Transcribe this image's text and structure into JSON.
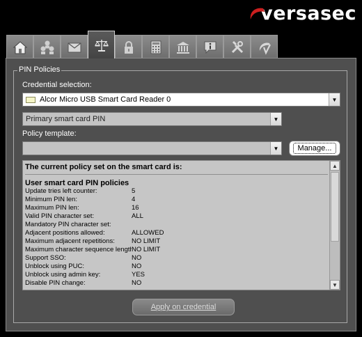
{
  "brand": {
    "logo_text": "versasec",
    "accent": "#cc1f1f"
  },
  "tabs": [
    {
      "name": "home-icon"
    },
    {
      "name": "users-icon"
    },
    {
      "name": "mail-icon"
    },
    {
      "name": "scales-icon",
      "active": true
    },
    {
      "name": "lock-icon"
    },
    {
      "name": "calculator-icon"
    },
    {
      "name": "bank-icon"
    },
    {
      "name": "info-icon"
    },
    {
      "name": "tools-icon"
    },
    {
      "name": "cv-icon"
    }
  ],
  "group": {
    "title": "PIN Policies"
  },
  "credential": {
    "label": "Credential selection:",
    "reader": "Alcor Micro USB Smart Card Reader 0",
    "pin_type": "Primary smart card PIN"
  },
  "policy": {
    "label": "Policy template:",
    "value": "",
    "manage_label": "Manage..."
  },
  "policy_list": {
    "heading": "The current policy set on the smart card is:",
    "section": "User smart card PIN policies",
    "rows": [
      {
        "key": "Update tries left counter:",
        "value": "5"
      },
      {
        "key": "Minimum PIN len:",
        "value": "4"
      },
      {
        "key": "Maximum PIN len:",
        "value": "16"
      },
      {
        "key": "Valid PIN character set:",
        "value": "ALL"
      },
      {
        "key": "Mandatory PIN character set:",
        "value": ""
      },
      {
        "key": "Adjacent positions allowed:",
        "value": "ALLOWED"
      },
      {
        "key": "Maximum adjacent repetitions:",
        "value": "NO LIMIT"
      },
      {
        "key": "Maximum character sequence length:",
        "value": "NO LIMIT"
      },
      {
        "key": "Support SSO:",
        "value": "NO"
      },
      {
        "key": "Unblock using PUC:",
        "value": "NO"
      },
      {
        "key": "Unblock using admin key:",
        "value": "YES"
      },
      {
        "key": "Disable PIN change:",
        "value": "NO"
      }
    ]
  },
  "apply_label": "Apply on credential"
}
